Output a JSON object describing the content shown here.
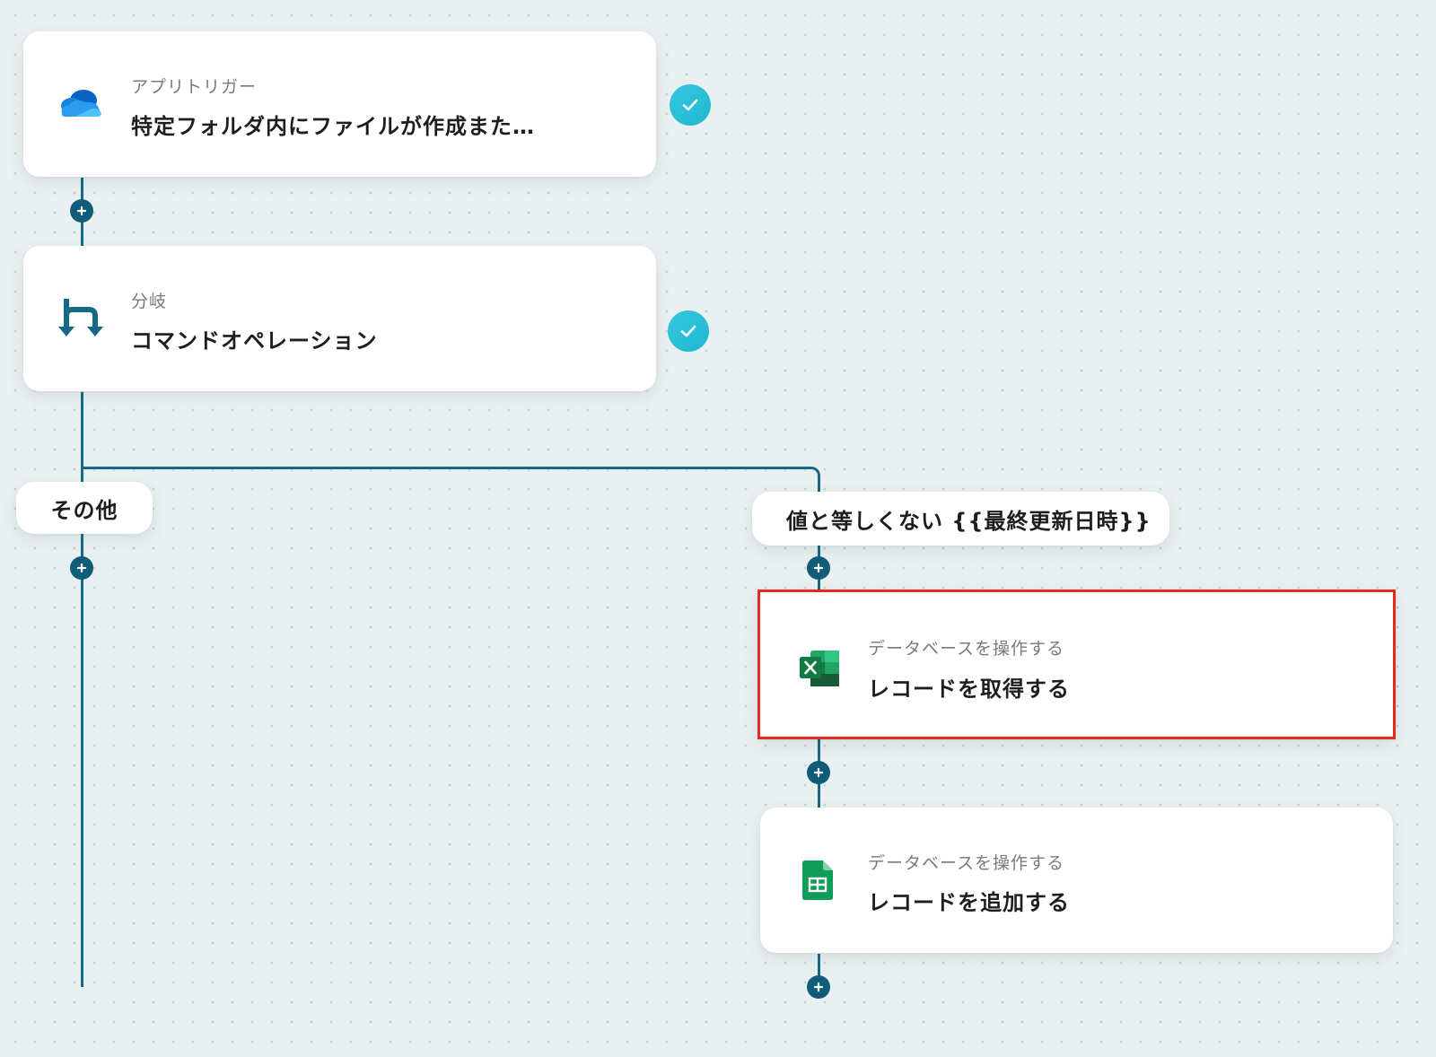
{
  "flow": {
    "steps": [
      {
        "id": "trigger",
        "subtitle": "アプリトリガー",
        "title": "特定フォルダ内にファイルが作成また…",
        "icon": "onedrive-icon",
        "status": "completed"
      },
      {
        "id": "branch",
        "subtitle": "分岐",
        "title": "コマンドオペレーション",
        "icon": "branch-icon",
        "status": "completed"
      }
    ],
    "branches": [
      {
        "label": "その他",
        "steps": []
      },
      {
        "label": "値と等しくない {{最終更新日時}}",
        "steps": [
          {
            "id": "excel",
            "subtitle": "データベースを操作する",
            "title": "レコードを取得する",
            "icon": "excel-icon",
            "selected": true
          },
          {
            "id": "sheets",
            "subtitle": "データベースを操作する",
            "title": "レコードを追加する",
            "icon": "google-sheets-icon",
            "selected": false
          }
        ]
      }
    ]
  },
  "colors": {
    "connector": "#176a85",
    "add_button": "#0f5d78",
    "check": "#35c6e0",
    "selection": "#e8291c",
    "background": "#e9f0f1"
  }
}
